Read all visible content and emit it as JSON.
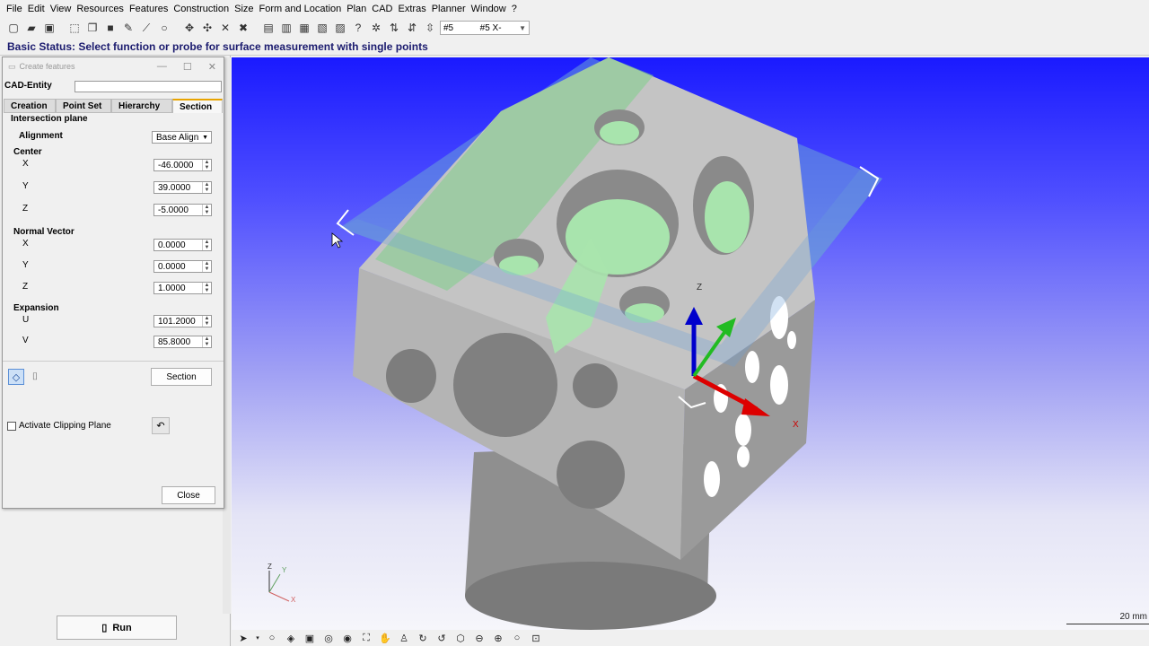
{
  "menu": [
    "File",
    "Edit",
    "View",
    "Resources",
    "Features",
    "Construction",
    "Size",
    "Form and Location",
    "Plan",
    "CAD",
    "Extras",
    "Planner",
    "Window",
    "?"
  ],
  "toolbar": {
    "icons": [
      "new-icon",
      "open-icon",
      "save-icon",
      "select-icon",
      "copy-icon",
      "paste-icon",
      "probe-icon",
      "measure-icon",
      "search-icon",
      "feature-icon",
      "rotate-icon",
      "cross-icon",
      "tools-icon",
      "print-icon",
      "delete-icon",
      "doc-icon",
      "report-icon",
      "clipboard-icon",
      "help-icon",
      "gear-icon",
      "probe2-icon",
      "probe3-icon"
    ],
    "combo_left": "#5",
    "combo_value": "#5 X-"
  },
  "status": "Basic Status: Select function or probe for surface measurement with single points",
  "dialog": {
    "title": "Create features",
    "cad_entity_label": "CAD-Entity",
    "cad_entity_value": "",
    "tabs": [
      "Creation",
      "Point Set",
      "Hierarchy",
      "Section"
    ],
    "active_tab": "Section",
    "intersection_plane": "Intersection plane",
    "alignment_label": "Alignment",
    "alignment_value": "Base Align",
    "center_label": "Center",
    "center": {
      "x_label": "X",
      "x": "-46.0000",
      "y_label": "Y",
      "y": "39.0000",
      "z_label": "Z",
      "z": "-5.0000"
    },
    "normal_label": "Normal Vector",
    "normal": {
      "x_label": "X",
      "x": "0.0000",
      "y_label": "Y",
      "y": "0.0000",
      "z_label": "Z",
      "z": "1.0000"
    },
    "expansion_label": "Expansion",
    "expansion": {
      "u_label": "U",
      "u": "101.2000",
      "v_label": "V",
      "v": "85.8000"
    },
    "section_button": "Section",
    "clipping_label": "Activate Clipping Plane",
    "close_button": "Close"
  },
  "run_button": "Run",
  "viewport": {
    "axis_labels": {
      "z": "Z",
      "x": "X"
    },
    "mini_axes": {
      "z": "Z",
      "y": "Y",
      "x": "X"
    },
    "scale": "20 mm"
  }
}
